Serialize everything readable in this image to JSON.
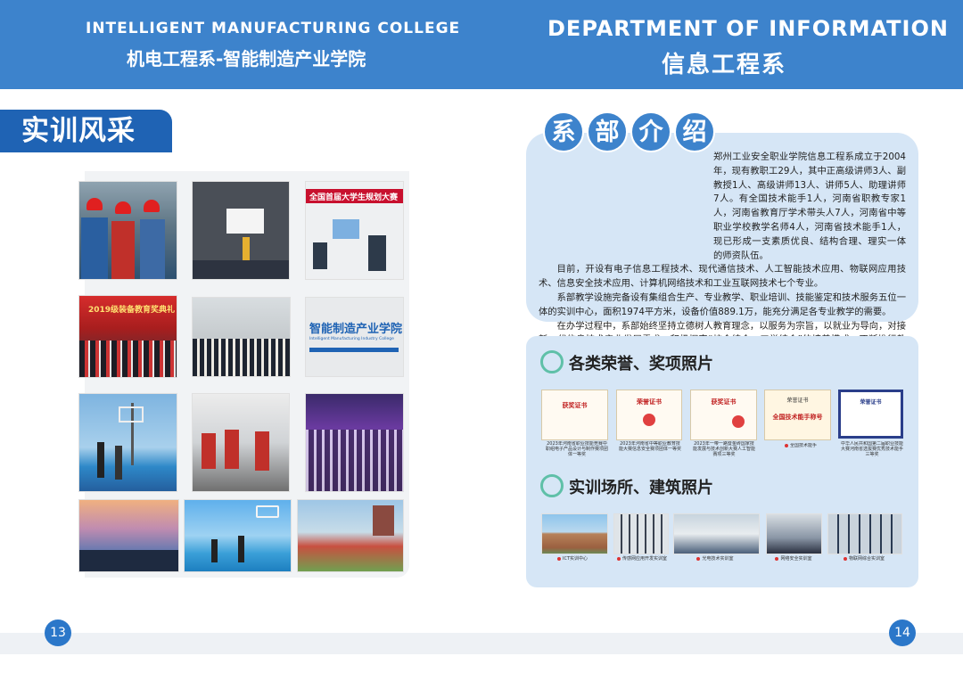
{
  "header": {
    "left_en": "INTELLIGENT MANUFACTURING COLLEGE",
    "left_cn": "机电工程系-智能制造产业学院",
    "right_en": "DEPARTMENT OF INFORMATION",
    "right_cn": "信息工程系"
  },
  "left": {
    "section_tag": "实训风采",
    "photo_texts": {
      "banner_top_right": "全国首届大学生规划大赛",
      "banner_mid_left": "2019级装备教育奖典礼",
      "building_sign_cn": "智能制造产业学院",
      "building_sign_en": "Intelligent Manufacturing Industry College"
    }
  },
  "intro": {
    "title_chars": [
      "系",
      "部",
      "介",
      "绍"
    ],
    "paragraphs": [
      "郑州工业安全职业学院信息工程系成立于2004年，现有教职工29人，其中正高级讲师3人、副教授1人、高级讲师13人、讲师5人、助理讲师7人。有全国技术能手1人，河南省职教专家1人，河南省教育厅学术带头人7人，河南省中等职业学校教学名师4人，河南省技术能手1人，现已形成一支素质优良、结构合理、理实一体的师资队伍。",
      "目前，开设有电子信息工程技术、现代通信技术、人工智能技术应用、物联网应用技术、信息安全技术应用、计算机网络技术和工业互联网技术七个专业。",
      "系部教学设施完备设有集组合生产、专业教学、职业培训、技能鉴定和技术服务五位一体的实训中心，面积1974平方米，设备价值889.1万，能充分满足各专业教学的需要。",
      "在办学过程中，系部始终坚持立德树人教育理念，以服务为宗旨，以就业为导向，对接新一代信息技术产业发展需求，积极探索“校企结合、工学结合”的培养模式，不断推行教学改革，将课程体系与行业认证相融合，专业知识与职业技能相贯通，鼓励学生积极参加专业相关的技能大赛和“1+X”证书培训，实现学生综合素质和实践技能的全面提高。"
    ]
  },
  "honors": {
    "title": "各类荣誉、奖项照片",
    "certificates": [
      {
        "heading": "获奖证书",
        "caption": "2023年河南省职业技能竞赛中职组电子产品设计与制作赛项团体一等奖"
      },
      {
        "heading": "荣誉证书",
        "caption": "2023年河南省中等职业教育技能大赛信息安全赛项团体一等奖"
      },
      {
        "heading": "获奖证书",
        "caption": "2023年一带一路暨金砖国家技能发展与技术创新大赛人工智能赛项三等奖"
      },
      {
        "heading": "荣誉证书",
        "caption": "全国技术能手",
        "title": "全国技术能手称号"
      },
      {
        "heading": "荣誉证书",
        "caption": "中华人民共和国第二届职业技能大赛河南省选拔赛优秀技术能手三等奖"
      }
    ]
  },
  "facilities": {
    "title": "实训场所、建筑照片",
    "photos": [
      {
        "caption": "ICT实训中心"
      },
      {
        "caption": "传感网应用开发实训室"
      },
      {
        "caption": "光电技术实训室"
      },
      {
        "caption": "网络安全实训室"
      },
      {
        "caption": "物联网综合实训室"
      }
    ]
  },
  "pages": {
    "left": "13",
    "right": "14"
  },
  "colors": {
    "header": "#3d83cc",
    "tag": "#1f63b4",
    "panel": "#d6e6f6",
    "accent": "#5fc0a8"
  }
}
